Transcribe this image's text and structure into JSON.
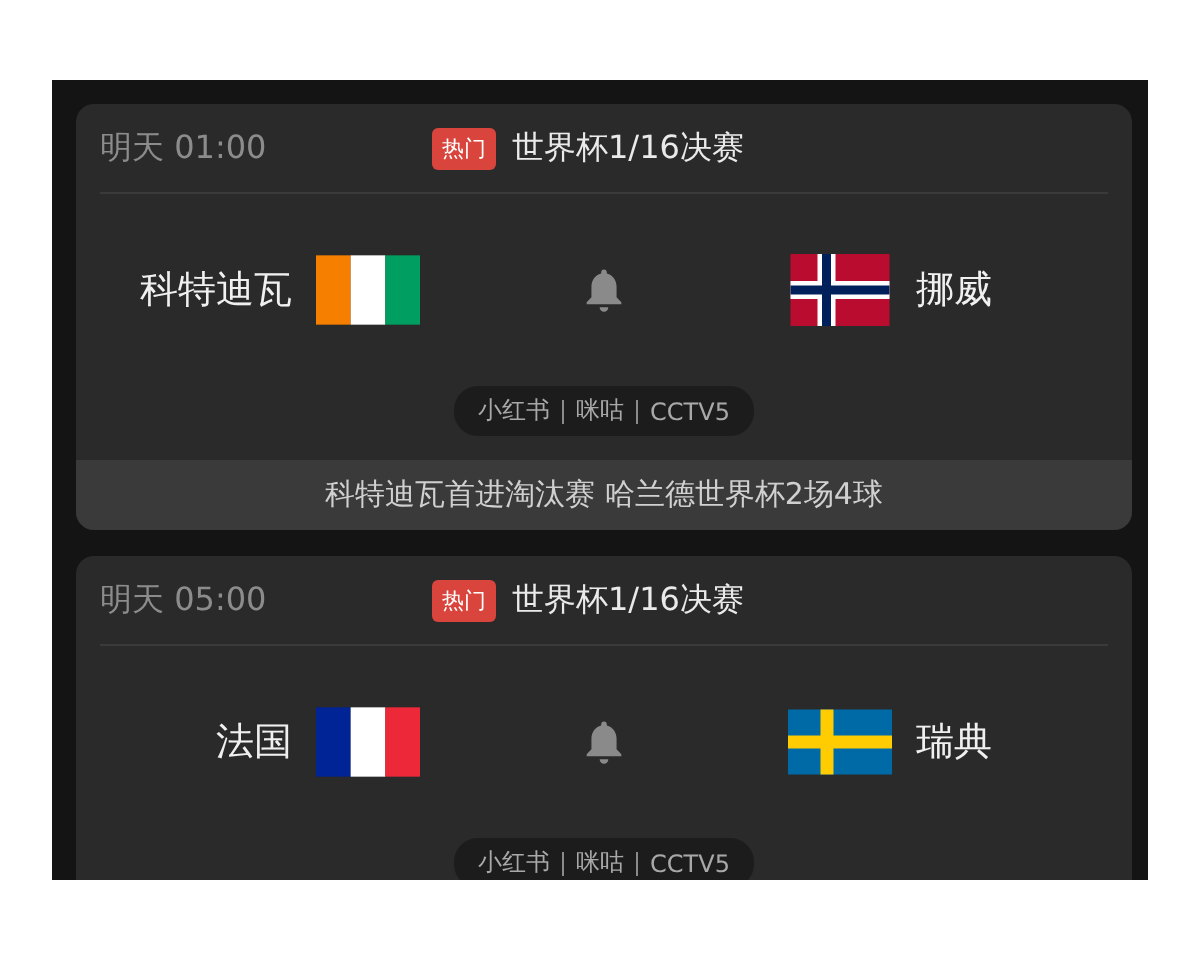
{
  "matches": [
    {
      "time": "明天 01:00",
      "badge": "热门",
      "stage": "世界杯1/16决赛",
      "home": {
        "name": "科特迪瓦",
        "kind": "civ"
      },
      "away": {
        "name": "挪威",
        "kind": "nor"
      },
      "channels": [
        "小红书",
        "咪咕",
        "CCTV5"
      ],
      "headline": "科特迪瓦首进淘汰赛 哈兰德世界杯2场4球"
    },
    {
      "time": "明天 05:00",
      "badge": "热门",
      "stage": "世界杯1/16决赛",
      "home": {
        "name": "法国",
        "kind": "fra"
      },
      "away": {
        "name": "瑞典",
        "kind": "swe"
      },
      "channels": [
        "小红书",
        "咪咕",
        "CCTV5"
      ]
    }
  ]
}
